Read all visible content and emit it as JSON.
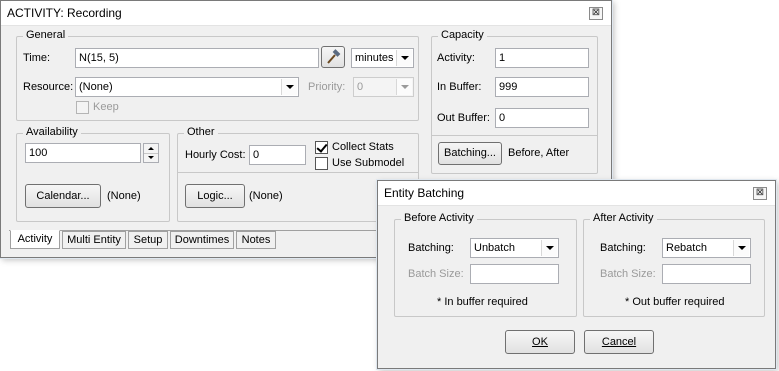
{
  "activity_window": {
    "title": "ACTIVITY: Recording",
    "close_glyph": "⊠",
    "general": {
      "legend": "General",
      "time_label": "Time:",
      "time_value": "N(15, 5)",
      "time_unit": "minutes",
      "resource_label": "Resource:",
      "resource_value": "(None)",
      "priority_label": "Priority:",
      "priority_value": "0",
      "keep_label": "Keep"
    },
    "capacity": {
      "legend": "Capacity",
      "activity_label": "Activity:",
      "activity_value": "1",
      "in_buffer_label": "In Buffer:",
      "in_buffer_value": "999",
      "out_buffer_label": "Out Buffer:",
      "out_buffer_value": "0",
      "batching_button": "Batching...",
      "batching_status": "Before, After"
    },
    "availability": {
      "legend": "Availability",
      "value": "100",
      "calendar_button": "Calendar...",
      "calendar_status": "(None)"
    },
    "other": {
      "legend": "Other",
      "hourly_cost_label": "Hourly Cost:",
      "hourly_cost_value": "0",
      "collect_stats_label": "Collect Stats",
      "use_submodel_label": "Use Submodel",
      "logic_button": "Logic...",
      "logic_status": "(None)"
    },
    "tabs": [
      "Activity",
      "Multi Entity",
      "Setup",
      "Downtimes",
      "Notes"
    ]
  },
  "batching_dialog": {
    "title": "Entity Batching",
    "close_glyph": "⊠",
    "before": {
      "legend": "Before Activity",
      "batching_label": "Batching:",
      "batching_value": "Unbatch",
      "batch_size_label": "Batch Size:",
      "note": "* In buffer required"
    },
    "after": {
      "legend": "After Activity",
      "batching_label": "Batching:",
      "batching_value": "Rebatch",
      "batch_size_label": "Batch Size:",
      "note": "* Out buffer required"
    },
    "ok_label": "OK",
    "cancel_label": "Cancel"
  }
}
